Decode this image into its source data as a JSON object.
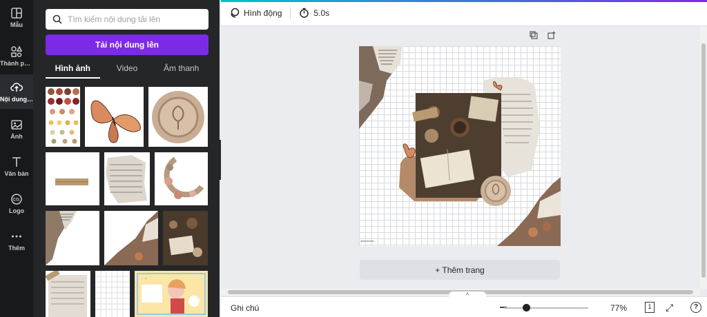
{
  "rail": {
    "items": [
      {
        "label": "Mẫu",
        "icon": "template-icon"
      },
      {
        "label": "Thành phần",
        "icon": "elements-icon"
      },
      {
        "label": "Nội dung ...",
        "icon": "upload-cloud-icon"
      },
      {
        "label": "Ảnh",
        "icon": "photo-icon"
      },
      {
        "label": "Văn bản",
        "icon": "text-icon"
      },
      {
        "label": "Logo",
        "icon": "logo-icon"
      },
      {
        "label": "Thêm",
        "icon": "more-icon"
      }
    ],
    "active_index": 2
  },
  "panel": {
    "search_placeholder": "Tìm kiếm nội dung tải lên",
    "upload_label": "Tải nội dung lên",
    "tabs": [
      "Hình ảnh",
      "Video",
      "Âm thanh"
    ],
    "active_tab": 0
  },
  "toolbar": {
    "animation_label": "Hình động",
    "duration_label": "5.0s"
  },
  "canvas": {
    "add_page_label": "+ Thêm trang",
    "caption_small": "@aesthetic"
  },
  "bottombar": {
    "notes_label": "Ghi chú",
    "zoom_value": "77%",
    "zoom_fraction": 0.27,
    "page_count": "1",
    "help_label": "?"
  },
  "colors": {
    "accent": "#7d2ae8",
    "rail_bg": "#18191b",
    "panel_bg": "#252627"
  }
}
